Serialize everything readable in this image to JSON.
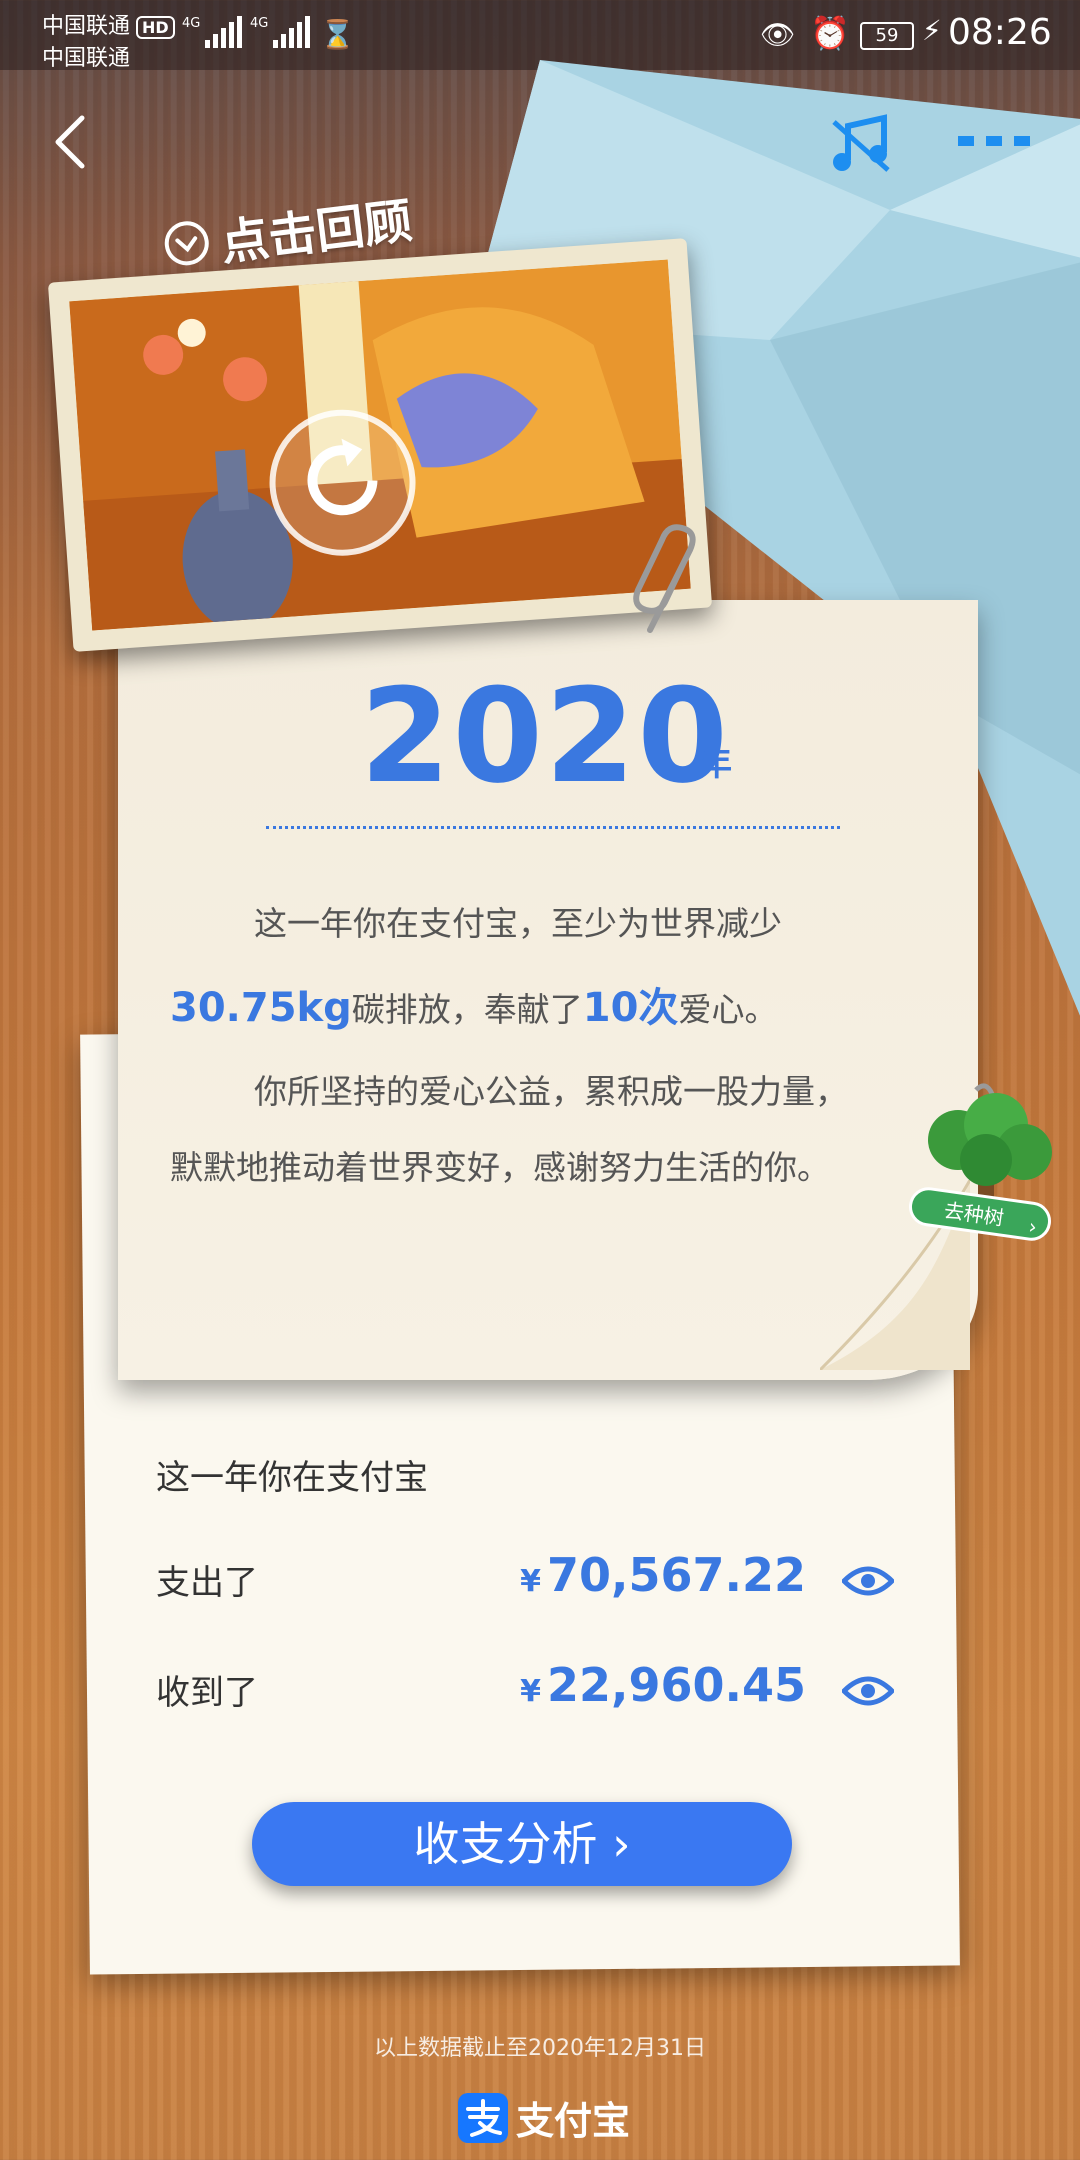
{
  "status_bar": {
    "carrier1": "中国联通",
    "carrier1_badge": "HD",
    "carrier2": "中国联通",
    "network1": "4G",
    "network2": "4G",
    "battery": "59",
    "time": "08:26"
  },
  "nav": {
    "back_icon": "chevron-left-icon",
    "music_icon": "music-off-icon",
    "more_icon": "more-dots-icon"
  },
  "photo": {
    "review_label": "点击回顾"
  },
  "annual": {
    "year": "2020",
    "year_suffix": "年",
    "p1": "这一年你在支付宝，至少为世界减少",
    "carbon": "30.75kg",
    "p2_mid": "碳排放，奉献了",
    "donations": "10次",
    "p2_end": "爱心。",
    "p3": "你所坚持的爱心公益，累积成一股力量，",
    "p4": "默默地推动着世界变好，感谢努力生活的你。"
  },
  "tree_badge": {
    "label": "去种树"
  },
  "summary": {
    "title": "这一年你在支付宝",
    "currency": "¥",
    "spent_label": "支出了",
    "spent_amount": "70,567.22",
    "received_label": "收到了",
    "received_amount": "22,960.45",
    "analysis_button": "收支分析 ›"
  },
  "footer": {
    "note": "以上数据截止至2020年12月31日",
    "brand": "支付宝"
  },
  "colors": {
    "accent": "#3a78e0",
    "button": "#3a78f2",
    "paper": "#f5efe2"
  }
}
